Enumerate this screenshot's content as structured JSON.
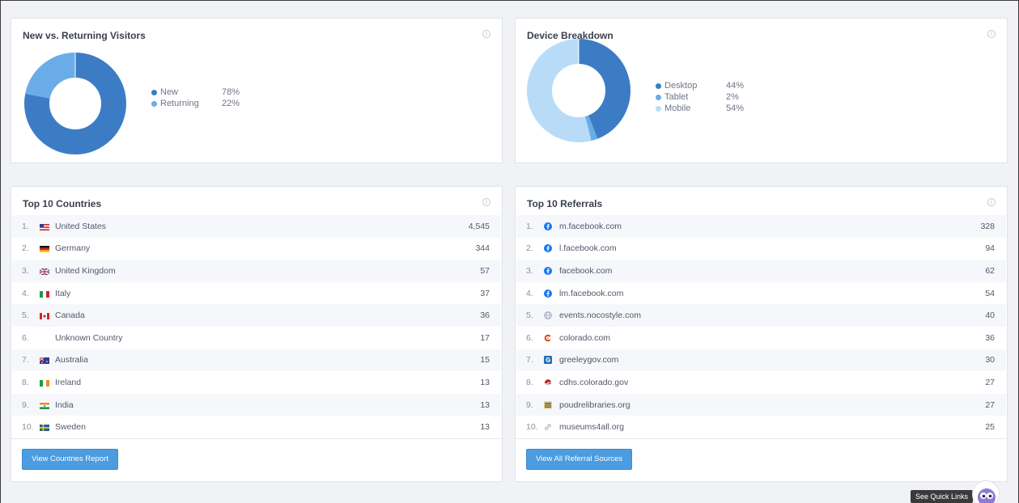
{
  "visitors": {
    "title": "New vs. Returning Visitors",
    "legend": [
      {
        "label": "New",
        "value": "78%",
        "color": "#3c7cc4"
      },
      {
        "label": "Returning",
        "value": "22%",
        "color": "#6aace8"
      }
    ]
  },
  "devices": {
    "title": "Device Breakdown",
    "legend": [
      {
        "label": "Desktop",
        "value": "44%",
        "color": "#3c7cc4"
      },
      {
        "label": "Tablet",
        "value": "2%",
        "color": "#6aace8"
      },
      {
        "label": "Mobile",
        "value": "54%",
        "color": "#b8dcf8"
      }
    ]
  },
  "countries": {
    "title": "Top 10 Countries",
    "rows": [
      {
        "rank": "1.",
        "name": "United States",
        "count": "4,545",
        "flag": "us-flag-icon"
      },
      {
        "rank": "2.",
        "name": "Germany",
        "count": "344",
        "flag": "germany-flag-icon"
      },
      {
        "rank": "3.",
        "name": "United Kingdom",
        "count": "57",
        "flag": "uk-flag-icon"
      },
      {
        "rank": "4.",
        "name": "Italy",
        "count": "37",
        "flag": "italy-flag-icon"
      },
      {
        "rank": "5.",
        "name": "Canada",
        "count": "36",
        "flag": "canada-flag-icon"
      },
      {
        "rank": "6.",
        "name": "Unknown Country",
        "count": "17",
        "flag": "none"
      },
      {
        "rank": "7.",
        "name": "Australia",
        "count": "15",
        "flag": "australia-flag-icon"
      },
      {
        "rank": "8.",
        "name": "Ireland",
        "count": "13",
        "flag": "ireland-flag-icon"
      },
      {
        "rank": "9.",
        "name": "India",
        "count": "13",
        "flag": "india-flag-icon"
      },
      {
        "rank": "10.",
        "name": "Sweden",
        "count": "13",
        "flag": "sweden-flag-icon"
      }
    ],
    "button": "View Countries Report"
  },
  "referrals": {
    "title": "Top 10 Referrals",
    "rows": [
      {
        "rank": "1.",
        "name": "m.facebook.com",
        "count": "328",
        "icon": "facebook-icon"
      },
      {
        "rank": "2.",
        "name": "l.facebook.com",
        "count": "94",
        "icon": "facebook-icon"
      },
      {
        "rank": "3.",
        "name": "facebook.com",
        "count": "62",
        "icon": "facebook-icon"
      },
      {
        "rank": "4.",
        "name": "lm.facebook.com",
        "count": "54",
        "icon": "facebook-icon"
      },
      {
        "rank": "5.",
        "name": "events.nocostyle.com",
        "count": "40",
        "icon": "globe-icon"
      },
      {
        "rank": "6.",
        "name": "colorado.com",
        "count": "36",
        "icon": "colorado-icon"
      },
      {
        "rank": "7.",
        "name": "greeleygov.com",
        "count": "30",
        "icon": "greeley-icon"
      },
      {
        "rank": "8.",
        "name": "cdhs.colorado.gov",
        "count": "27",
        "icon": "cdhs-icon"
      },
      {
        "rank": "9.",
        "name": "poudrelibraries.org",
        "count": "27",
        "icon": "library-icon"
      },
      {
        "rank": "10.",
        "name": "museums4all.org",
        "count": "25",
        "icon": "link-icon"
      }
    ],
    "button": "View All Referral Sources"
  },
  "quick_links": "See Quick Links"
}
